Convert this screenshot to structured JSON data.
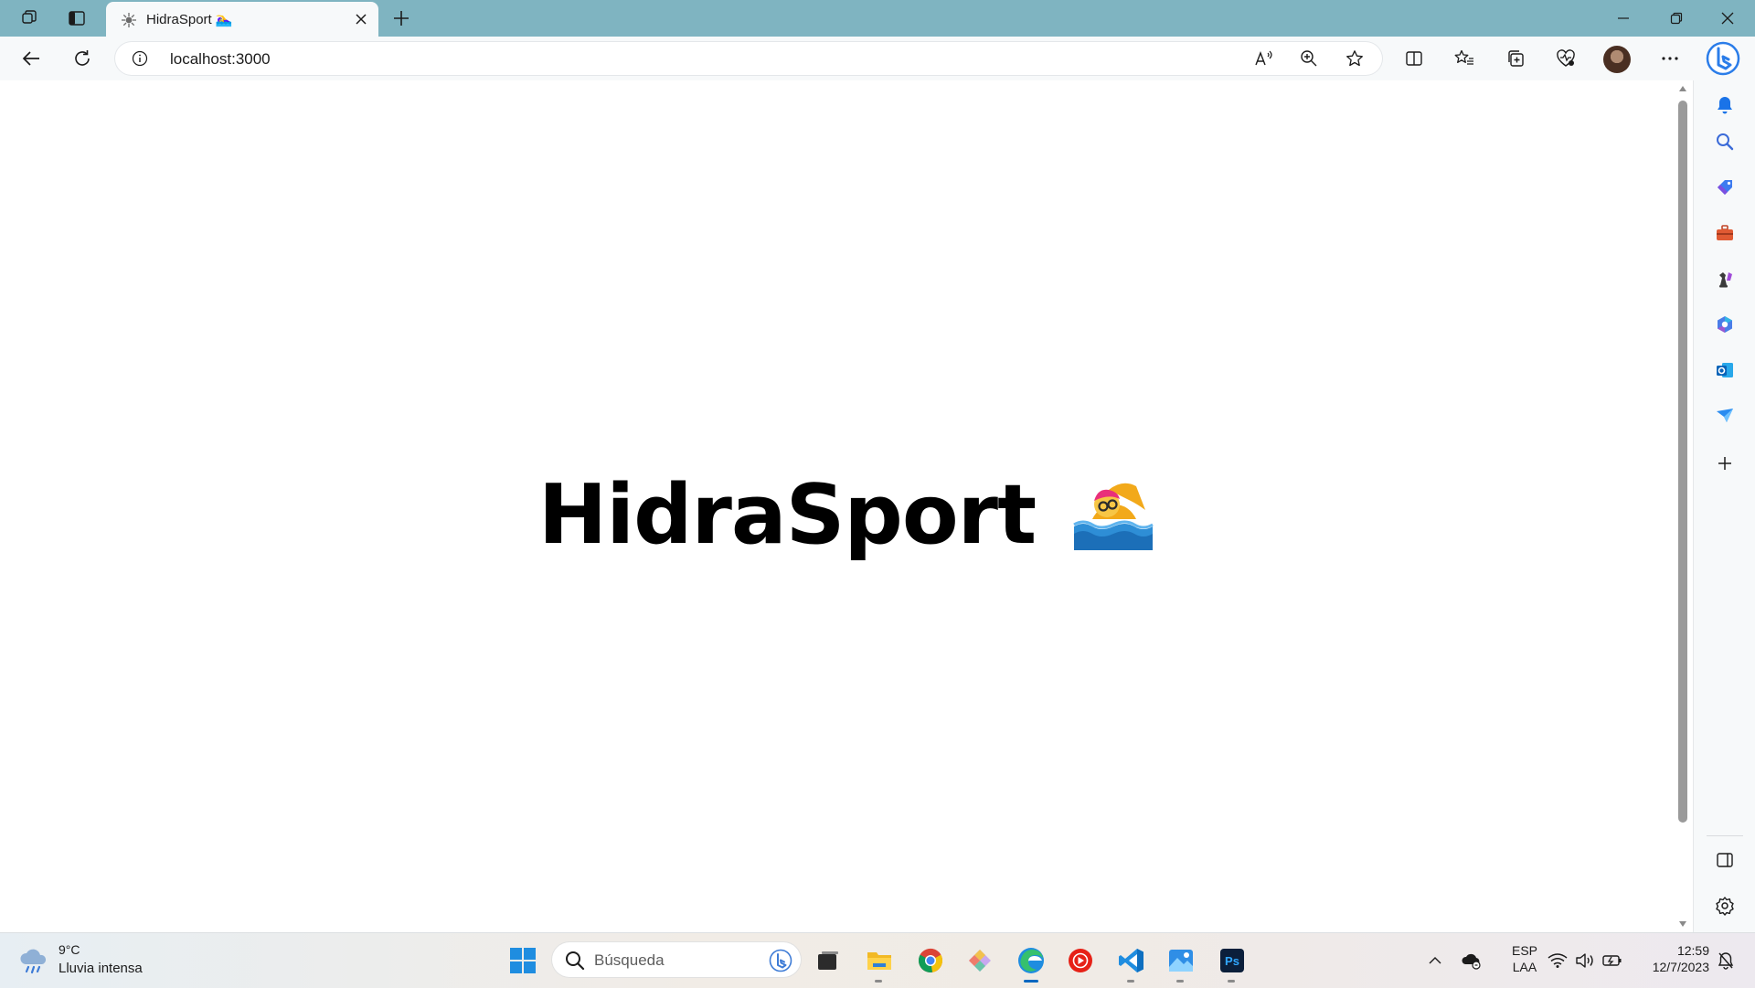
{
  "browser": {
    "tab": {
      "title": "HidraSport 🏊‍♀️"
    },
    "address_bar": {
      "url": "localhost:3000"
    }
  },
  "page": {
    "heading": "HidraSport"
  },
  "taskbar": {
    "weather": {
      "temperature": "9°C",
      "condition": "Lluvia intensa"
    },
    "search": {
      "placeholder": "Búsqueda"
    },
    "language": {
      "line1": "ESP",
      "line2": "LAA"
    },
    "clock": {
      "time": "12:59",
      "date": "12/7/2023"
    }
  },
  "icons": {
    "titlebar": [
      "workspaces-icon",
      "vertical-tabs-icon",
      "tab-favicon-icon",
      "tab-close-icon",
      "new-tab-icon",
      "minimize-icon",
      "restore-icon",
      "close-window-icon"
    ],
    "toolbar": [
      "back-icon",
      "refresh-icon",
      "site-info-icon",
      "read-aloud-icon",
      "zoom-icon",
      "favorite-star-icon",
      "split-screen-icon",
      "favorites-icon",
      "collections-icon",
      "browser-essentials-icon",
      "profile-avatar",
      "more-icon",
      "bing-copilot-icon"
    ],
    "sidebar": [
      "bell-icon",
      "search-icon",
      "shopping-tag-icon",
      "tools-briefcase-icon",
      "games-icon",
      "microsoft-365-icon",
      "outlook-icon",
      "drop-icon",
      "add-icon",
      "hide-sidebar-icon",
      "settings-icon"
    ],
    "taskbar": [
      "windows-start-icon",
      "task-view-icon",
      "file-explorer-icon",
      "chrome-icon",
      "git-kraken-icon",
      "edge-icon",
      "youtube-music-icon",
      "vscode-icon",
      "photos-icon",
      "photoshop-icon",
      "show-hidden-icons",
      "onedrive-icon",
      "wifi-icon",
      "volume-icon",
      "battery-icon",
      "notifications-icon"
    ]
  },
  "colors": {
    "titlebar": "#7fb4c1",
    "toolbar": "#f7f9fa",
    "accent": "#0067c0",
    "heading": "#000000"
  }
}
